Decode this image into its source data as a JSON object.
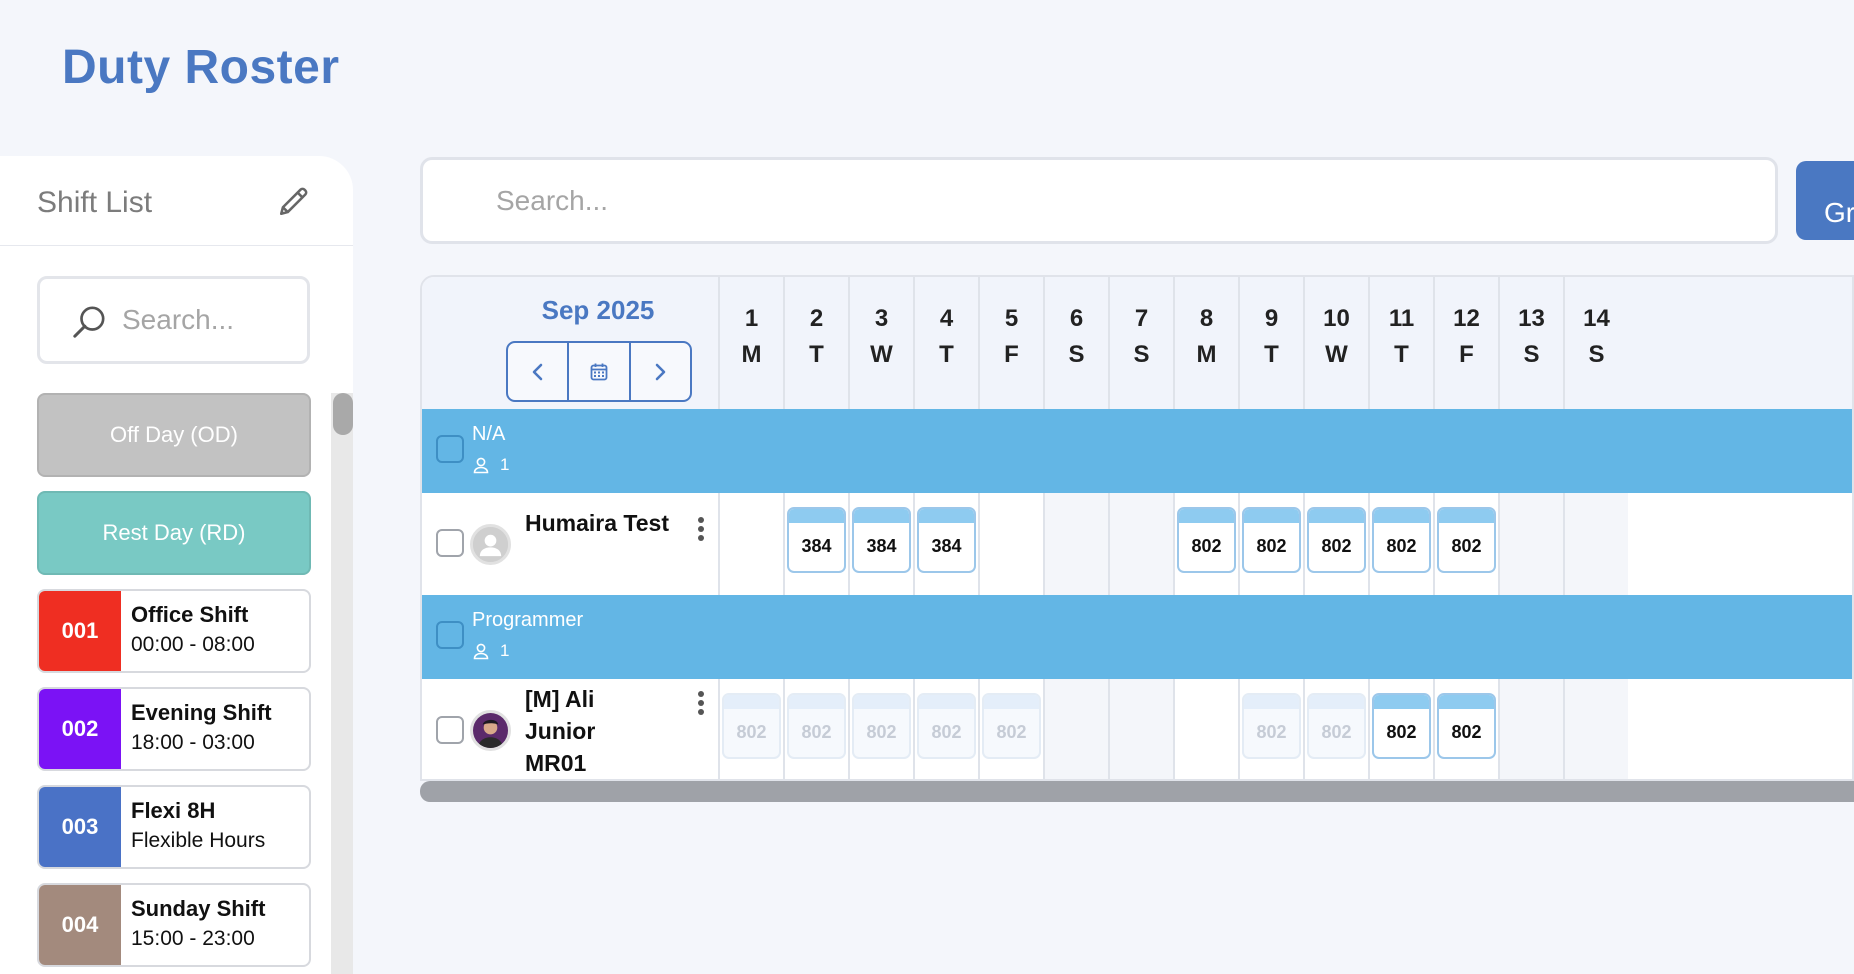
{
  "page": {
    "title": "Duty Roster"
  },
  "sidebar": {
    "title": "Shift List",
    "search_placeholder": "Search...",
    "day_types": [
      {
        "label": "Off Day (OD)",
        "color": "#c2c2c2"
      },
      {
        "label": "Rest Day (RD)",
        "color": "#79c9c4"
      }
    ],
    "shifts": [
      {
        "code": "001",
        "name": "Office Shift",
        "time": "00:00 - 08:00",
        "color": "#ef2e22"
      },
      {
        "code": "002",
        "name": "Evening Shift",
        "time": "18:00 - 03:00",
        "color": "#7b12f5"
      },
      {
        "code": "003",
        "name": "Flexi 8H",
        "time": "Flexible Hours",
        "color": "#4a72c6"
      },
      {
        "code": "004",
        "name": "Sunday Shift",
        "time": "15:00 - 23:00",
        "color": "#a38a7d"
      }
    ]
  },
  "main": {
    "search_placeholder": "Search...",
    "group_button": "Gr"
  },
  "roster": {
    "month": "Sep 2025",
    "days": [
      {
        "num": "1",
        "dow": "M"
      },
      {
        "num": "2",
        "dow": "T"
      },
      {
        "num": "3",
        "dow": "W"
      },
      {
        "num": "4",
        "dow": "T"
      },
      {
        "num": "5",
        "dow": "F"
      },
      {
        "num": "6",
        "dow": "S"
      },
      {
        "num": "7",
        "dow": "S"
      },
      {
        "num": "8",
        "dow": "M"
      },
      {
        "num": "9",
        "dow": "T"
      },
      {
        "num": "10",
        "dow": "W"
      },
      {
        "num": "11",
        "dow": "T"
      },
      {
        "num": "12",
        "dow": "F"
      },
      {
        "num": "13",
        "dow": "S"
      },
      {
        "num": "14",
        "dow": "S"
      }
    ],
    "groups": [
      {
        "name": "N/A",
        "count": "1",
        "employees": [
          {
            "name": "Humaira Test",
            "avatar": "default",
            "cells": [
              "",
              "384",
              "384",
              "384",
              "",
              "",
              "",
              "802",
              "802",
              "802",
              "802",
              "802",
              "",
              ""
            ],
            "faded": []
          }
        ]
      },
      {
        "name": "Programmer",
        "count": "1",
        "employees": [
          {
            "name": "[M] Ali Junior MR01",
            "avatar": "photo",
            "cells": [
              "802",
              "802",
              "802",
              "802",
              "802",
              "",
              "",
              "",
              "802",
              "802",
              "802",
              "802",
              "",
              ""
            ],
            "faded": [
              0,
              1,
              2,
              3,
              4,
              8,
              9
            ]
          }
        ]
      }
    ]
  }
}
